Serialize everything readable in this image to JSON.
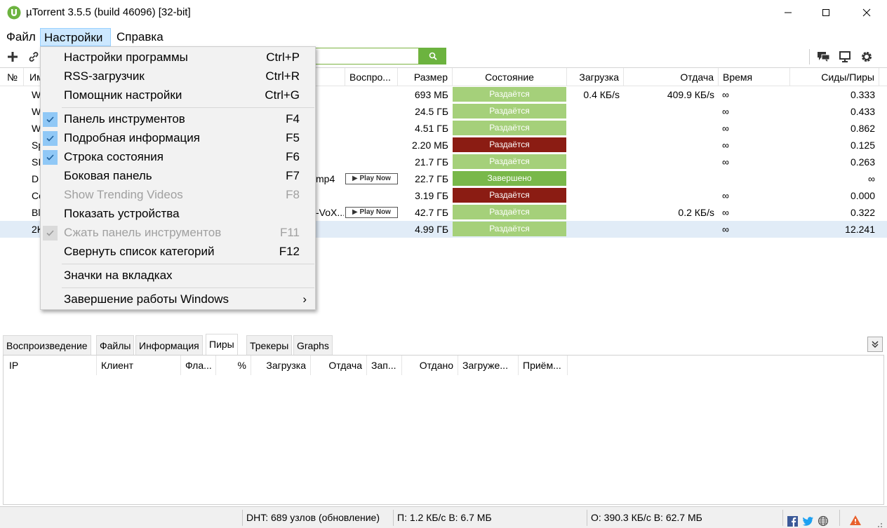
{
  "window": {
    "title": "µTorrent 3.5.5  (build 46096) [32-bit]"
  },
  "menubar": {
    "file": "Файл",
    "settings": "Настройки",
    "help": "Справка"
  },
  "table": {
    "headers": {
      "num": "№",
      "name": "Им",
      "play": "Воспро...",
      "size": "Размер",
      "status": "Состояние",
      "down": "Загрузка",
      "up": "Отдача",
      "time": "Время",
      "seeds": "Сиды/Пиры"
    },
    "rows": [
      {
        "name": "W",
        "extra": "",
        "play": "",
        "size": "693 МБ",
        "status": "Раздаётся",
        "status_color": "#a5d07a",
        "down": "0.4 КБ/s",
        "up": "409.9 КБ/s",
        "time": "∞",
        "seeds": "0.333"
      },
      {
        "name": "W",
        "extra": "",
        "play": "",
        "size": "24.5 ГБ",
        "status": "Раздаётся",
        "status_color": "#a5d07a",
        "down": "",
        "up": "",
        "time": "∞",
        "seeds": "0.433"
      },
      {
        "name": "W",
        "extra": "",
        "play": "",
        "size": "4.51 ГБ",
        "status": "Раздаётся",
        "status_color": "#a5d07a",
        "down": "",
        "up": "",
        "time": "∞",
        "seeds": "0.862"
      },
      {
        "name": "Sp",
        "extra": "",
        "play": "",
        "size": "2.20 МБ",
        "status": "Раздаётся",
        "status_color": "#8b1c13",
        "down": "",
        "up": "",
        "time": "∞",
        "seeds": "0.125"
      },
      {
        "name": "SI",
        "extra": "",
        "play": "",
        "size": "21.7 ГБ",
        "status": "Раздаётся",
        "status_color": "#a5d07a",
        "down": "",
        "up": "",
        "time": "∞",
        "seeds": "0.263"
      },
      {
        "name": "D",
        "extra": "mp4",
        "play": "▶ Play Now",
        "size": "22.7 ГБ",
        "status": "Завершено",
        "status_color": "#79b84a",
        "down": "",
        "up": "",
        "time": "",
        "seeds": "∞"
      },
      {
        "name": "Co",
        "extra": "",
        "play": "",
        "size": "3.19 ГБ",
        "status": "Раздаётся",
        "status_color": "#8b1c13",
        "down": "",
        "up": "",
        "time": "∞",
        "seeds": "0.000"
      },
      {
        "name": "Bl",
        "extra": "-VoX...",
        "play": "▶ Play Now",
        "size": "42.7 ГБ",
        "status": "Раздаётся",
        "status_color": "#a5d07a",
        "down": "",
        "up": "0.2 КБ/s",
        "time": "∞",
        "seeds": "0.322"
      },
      {
        "name": "2K",
        "extra": "",
        "play": "",
        "size": "4.99 ГБ",
        "status": "Раздаётся",
        "status_color": "#a5d07a",
        "down": "",
        "up": "",
        "time": "∞",
        "seeds": "12.241"
      }
    ]
  },
  "dropdown": {
    "items": [
      {
        "label": "Настройки программы",
        "shortcut": "Ctrl+P"
      },
      {
        "label": "RSS-загрузчик",
        "shortcut": "Ctrl+R"
      },
      {
        "label": "Помощник настройки",
        "shortcut": "Ctrl+G"
      },
      {
        "label": "Панель инструментов",
        "shortcut": "F4"
      },
      {
        "label": "Подробная информация",
        "shortcut": "F5"
      },
      {
        "label": "Строка состояния",
        "shortcut": "F6"
      },
      {
        "label": "Боковая панель",
        "shortcut": "F7"
      },
      {
        "label": "Show Trending Videos",
        "shortcut": "F8"
      },
      {
        "label": "Показать устройства",
        "shortcut": ""
      },
      {
        "label": "Сжать панель инструментов",
        "shortcut": "F11"
      },
      {
        "label": "Свернуть список категорий",
        "shortcut": "F12"
      },
      {
        "label": "Значки на вкладках",
        "shortcut": ""
      },
      {
        "label": "Завершение работы Windows",
        "shortcut": "›"
      }
    ]
  },
  "tabs": [
    "Воспроизведение",
    "Файлы",
    "Информация",
    "Пиры",
    "Трекеры",
    "Graphs"
  ],
  "peers": {
    "headers": [
      "IP",
      "Клиент",
      "Фла...",
      "%",
      "Загрузка",
      "Отдача",
      "Зап...",
      "Отдано",
      "Загруже...",
      "Приём..."
    ]
  },
  "statusbar": {
    "dht": "DHT: 689 узлов  (обновление)",
    "down": "П: 1.2 КБ/с В: 6.7 МБ",
    "up": "О: 390.3 КБ/с В: 62.7 МБ"
  }
}
